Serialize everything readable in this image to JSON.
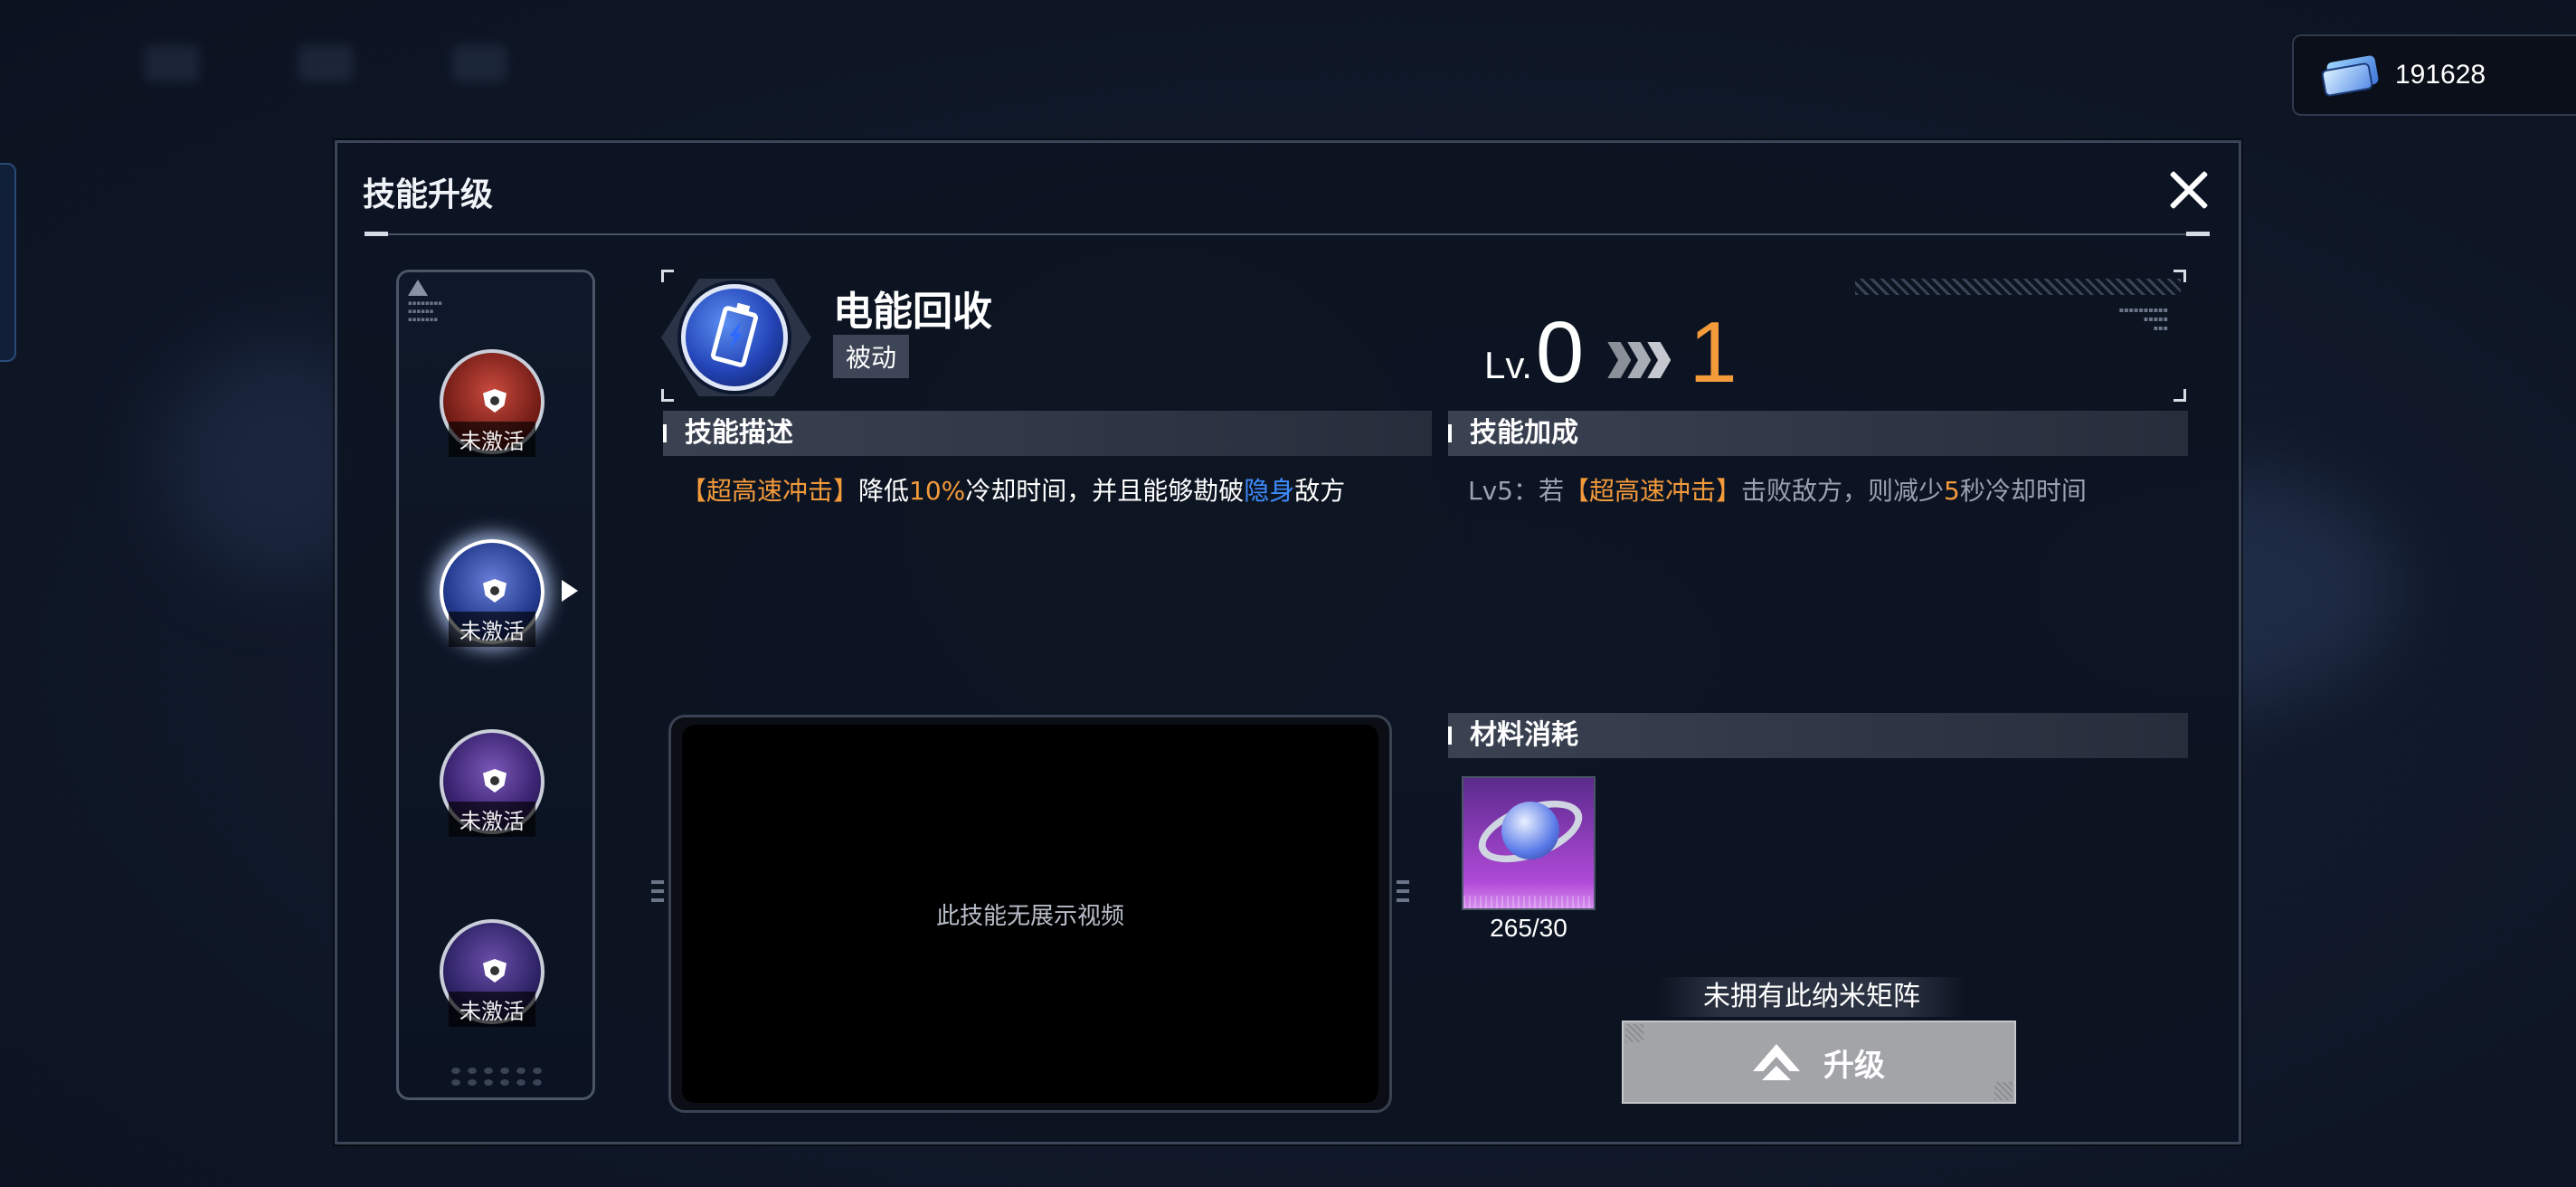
{
  "currency": {
    "icon": "ticket-icon",
    "amount": "191628"
  },
  "panel": {
    "title": "技能升级",
    "close_icon": "close-icon"
  },
  "skills": [
    {
      "status": "未激活",
      "color": "#8a2a24"
    },
    {
      "status": "未激活",
      "color": "#2e3f8e",
      "selected": true
    },
    {
      "status": "未激活",
      "color": "#4a2f7a"
    },
    {
      "status": "未激活",
      "color": "#3b2c6e"
    }
  ],
  "skill": {
    "name": "电能回收",
    "type": "被动",
    "level_prefix": "Lv.",
    "level_current": "0",
    "level_next": "1"
  },
  "description": {
    "header": "技能描述",
    "parts": [
      "【超高速冲击】",
      "降低",
      "10%",
      "冷却时间，并且能够勘破",
      "隐身",
      "敌方"
    ]
  },
  "bonus": {
    "header": "技能加成",
    "parts": [
      "Lv5：若",
      "【超高速冲击】",
      "击败敌方，则减少",
      "5",
      "秒冷却时间"
    ]
  },
  "video": {
    "placeholder": "此技能无展示视频"
  },
  "materials": {
    "header": "材料消耗",
    "items": [
      {
        "icon": "nano-core-icon",
        "count": "265/30"
      }
    ]
  },
  "footer": {
    "not_owned": "未拥有此纳米矩阵",
    "upgrade_label": "升级"
  },
  "colors": {
    "accent_orange": "#f39a3b",
    "accent_blue": "#3e8dff"
  }
}
